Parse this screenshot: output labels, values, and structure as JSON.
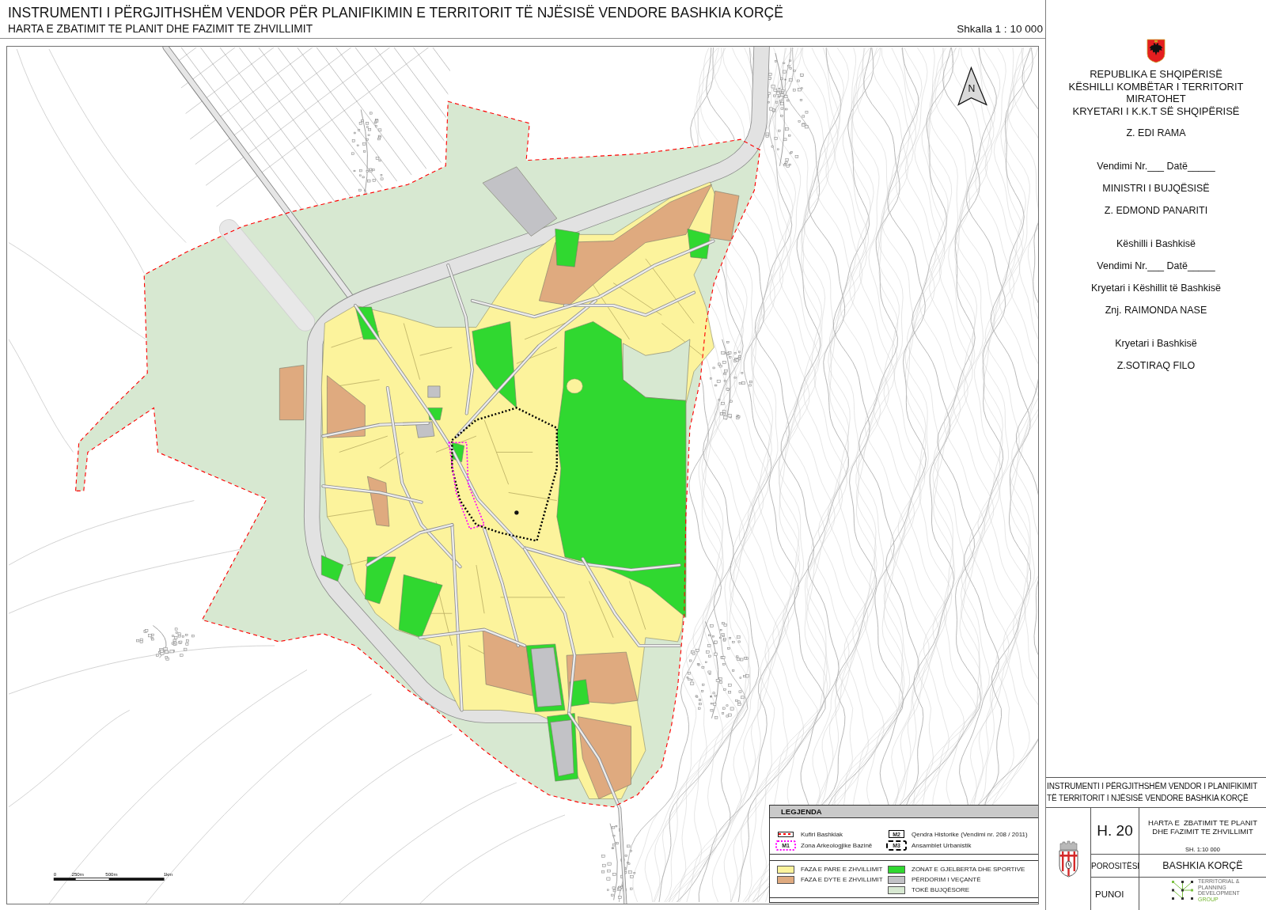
{
  "header": {
    "title": "INSTRUMENTI I PËRGJITHSHËM VENDOR PËR PLANIFIKIMIN E TERRITORIT TË NJËSISË VENDORE BASHKIA KORÇË",
    "subtitle": "HARTA E ZBATIMIT TE PLANIT DHE FAZIMIT TE ZHVILLIMIT",
    "scale": "Shkalla 1 : 10 000"
  },
  "map": {
    "north_label": "N",
    "scale_labels": [
      "0",
      "250m",
      "500m",
      "1km"
    ]
  },
  "legend": {
    "title": "LEGJENDA",
    "line_columns": [
      [
        {
          "kind": "boundary",
          "label": "Kufiri Bashkiak",
          "color": "#ff0000"
        },
        {
          "kind": "archaeological",
          "symbol_label": "M1",
          "label": "Zona Arkeologjike Bazinë",
          "color": "#ff00ff"
        }
      ],
      [
        {
          "kind": "historic_center",
          "symbol_label": "M2",
          "label": "Qendra Historike (Vendimi nr. 208 / 2011)",
          "color": "#000000"
        },
        {
          "kind": "ensemble",
          "symbol_label": "M3",
          "label": "Ansamblet Urbanistik",
          "color": "#000000"
        }
      ]
    ],
    "fill_columns": [
      [
        {
          "label": "FAZA E PARE E ZHVILLIMIT",
          "color": "#fcf39c"
        },
        {
          "label": "FAZA E DYTE E ZHVILLIMIT",
          "color": "#dfaa7f"
        }
      ],
      [
        {
          "label": "ZONAT E GJELBERTA DHE SPORTIVE",
          "color": "#30d830"
        },
        {
          "label": "PËRDORIM I VEÇANTË",
          "color": "#c2c2c6"
        },
        {
          "label": "TOKË BUJQËSORE",
          "color": "#d7e8d1"
        }
      ]
    ]
  },
  "approval_panel": {
    "authority_lines": [
      "REPUBLIKA E SHQIPËRISË",
      "KËSHILLI KOMBËTAR I TERRITORIT",
      "MIRATOHET",
      "KRYETARI I K.K.T SË SHQIPËRISË"
    ],
    "groups": [
      [
        "Z. EDI RAMA"
      ],
      [
        "Vendimi Nr.___ Datë_____",
        "MINISTRI I BUJQËSISË",
        "Z. EDMOND PANARITI"
      ],
      [
        "Këshilli i Bashkisë",
        "Vendimi Nr.___ Datë_____",
        "Kryetari i Këshillit të Bashkisë",
        "Znj. RAIMONDA NASE"
      ],
      [
        "Kryetari i Bashkisë",
        "Z.SOTIRAQ FILO"
      ]
    ]
  },
  "title_block": {
    "heading_lines": [
      "INSTRUMENTI I PËRGJITHSHËM VENDOR I PLANIFIKIMIT",
      "TË TERRITORIT I NJËSISË VENDORE BASHKIA KORÇË"
    ],
    "sheet_number": "H. 20",
    "sheet_title_lines": [
      "HARTA E  ZBATIMIT TE PLANIT",
      "DHE FAZIMIT TE ZHVILLIMIT"
    ],
    "sheet_scale": "SH. 1:10 000",
    "client_label": "POROSITËSI",
    "client": "BASHKIA KORÇË",
    "author_label": "PUNOI",
    "author": {
      "name_lines": [
        "TERRITORIAL &",
        "PLANNING",
        "DEVELOPMENT"
      ],
      "group_label": "GROUP"
    }
  }
}
